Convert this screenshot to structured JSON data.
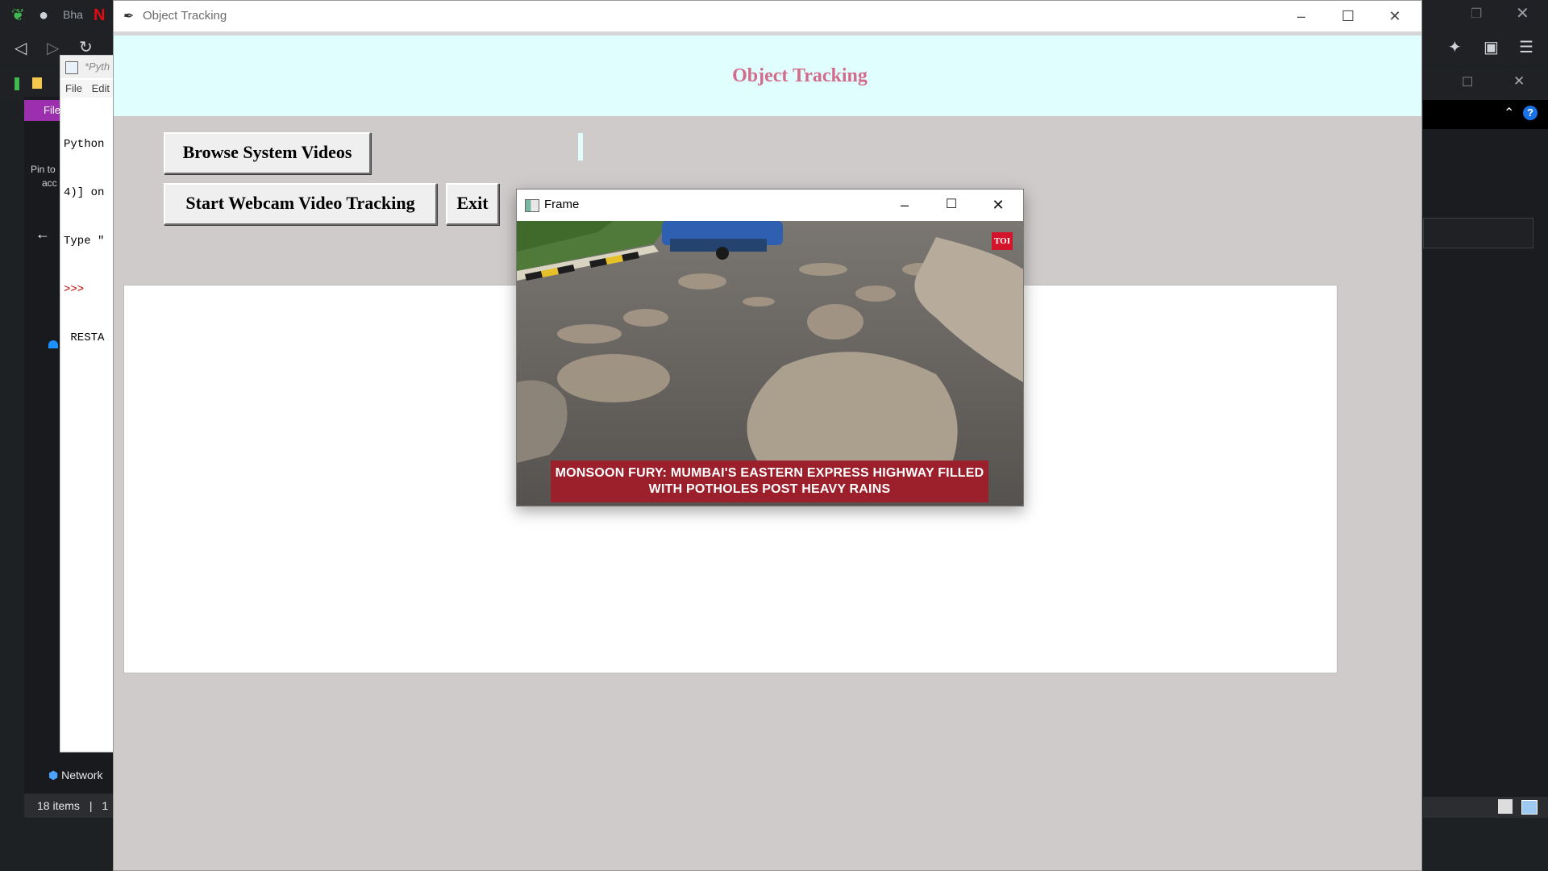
{
  "background_browser": {
    "tab_label": "Bha",
    "icons": [
      "app-logo-icon",
      "github-icon",
      "netflix-icon",
      "back-icon",
      "forward-icon",
      "reload-icon",
      "extensions-icon",
      "wallet-icon",
      "menu-icon",
      "restore-icon",
      "close-icon"
    ]
  },
  "explorer": {
    "menu_label": "File",
    "pin_text_1": "Pin to",
    "pin_text_2": "acc",
    "network_label": "Network",
    "status_items": "18 items",
    "status_sep": "|",
    "status_extra": "1"
  },
  "idle_shell": {
    "title": "*Pyth",
    "menu_file": "File",
    "menu_edit": "Edit",
    "line1": "Python",
    "line2": "4)] on",
    "line3": "Type \"",
    "prompt": ">>>",
    "line5": " RESTA"
  },
  "main_window": {
    "title": "Object Tracking",
    "header_title": "Object Tracking",
    "buttons": {
      "browse": "Browse System Videos",
      "webcam": "Start Webcam Video Tracking",
      "exit": "Exit"
    },
    "colors": {
      "header_bg": "#e0fefe",
      "header_text": "#d36b8a",
      "body_bg": "#cfcbcb"
    }
  },
  "frame_window": {
    "title": "Frame",
    "news_line1": "MONSOON FURY: MUMBAI'S EASTERN EXPRESS HIGHWAY FILLED",
    "news_line2": "WITH POTHOLES POST HEAVY RAINS",
    "logo_text": "TOI"
  }
}
